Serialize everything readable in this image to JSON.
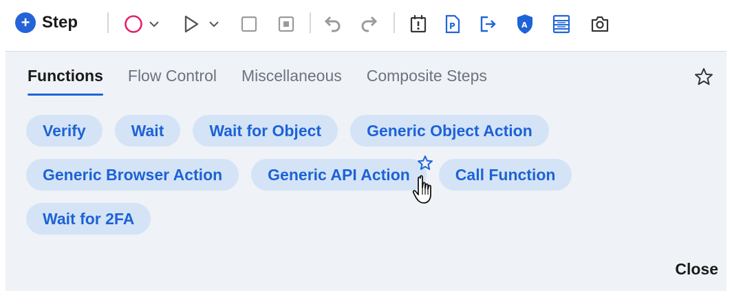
{
  "toolbar": {
    "step_label": "Step",
    "icons": [
      "add-step-icon",
      "record-icon",
      "chevron-down-icon",
      "run-icon",
      "chevron-down-icon",
      "stop-icon",
      "pause-icon",
      "undo-icon",
      "redo-icon",
      "checkpoint-icon",
      "parameter-icon",
      "export-icon",
      "shield-icon",
      "datatable-icon",
      "camera-icon"
    ],
    "colors": {
      "record": "#e0206a",
      "accent": "#1e64d8",
      "disabled": "#9a9a9a"
    }
  },
  "panel": {
    "tabs": [
      {
        "label": "Functions",
        "active": true
      },
      {
        "label": "Flow Control",
        "active": false
      },
      {
        "label": "Miscellaneous",
        "active": false
      },
      {
        "label": "Composite Steps",
        "active": false
      }
    ],
    "chips": [
      [
        "Verify",
        "Wait",
        "Wait for Object",
        "Generic Object Action"
      ],
      [
        "Generic Browser Action",
        "Generic API Action",
        "Call Function"
      ],
      [
        "Wait for 2FA"
      ]
    ],
    "close_label": "Close"
  }
}
